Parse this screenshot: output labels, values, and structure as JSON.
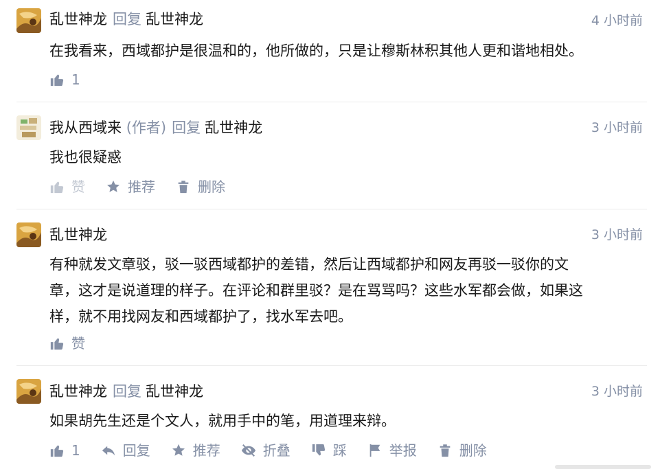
{
  "comments": [
    {
      "author": "乱世神龙",
      "role": "",
      "reply_word": "回复",
      "reply_to": "乱世神龙",
      "time": "4 小时前",
      "content": "在我看来，西域都护是很温和的，他所做的，只是让穆斯林积其他人更和谐地相处。",
      "like_count": "1"
    },
    {
      "author": "我从西域来",
      "role": "(作者)",
      "reply_word": "回复",
      "reply_to": "乱世神龙",
      "time": "3 小时前",
      "content": "我也很疑惑",
      "like_label": "赞",
      "recommend_label": "推荐",
      "delete_label": "删除"
    },
    {
      "author": "乱世神龙",
      "time": "3 小时前",
      "content_lines": [
        "有种就发文章驳，驳一驳西域都护的差错，然后让西域都护和网友再驳一驳你的文",
        "章，这才是说道理的样子。在评论和群里驳？是在骂骂吗？这些水军都会做，如果这",
        "样，就不用找网友和西域都护了，找水军去吧。"
      ],
      "like_label": "赞"
    },
    {
      "author": "乱世神龙",
      "reply_word": "回复",
      "reply_to": "乱世神龙",
      "time": "3 小时前",
      "content": "如果胡先生还是个文人，就用手中的笔，用道理来辩。",
      "like_count": "1",
      "reply_label": "回复",
      "recommend_label": "推荐",
      "fold_label": "折叠",
      "dislike_label": "踩",
      "report_label": "举报",
      "delete_label": "删除"
    }
  ],
  "icons": {
    "like": "thumbs-up-icon",
    "reply": "reply-arrow-icon",
    "recommend": "star-icon",
    "fold": "eye-slash-icon",
    "dislike": "thumbs-down-icon",
    "report": "flag-icon",
    "delete": "trash-icon"
  },
  "colors": {
    "text": "#1a1a1a",
    "meta": "#8590a6",
    "muted": "#c2c8d2",
    "divider": "#ebebeb"
  }
}
